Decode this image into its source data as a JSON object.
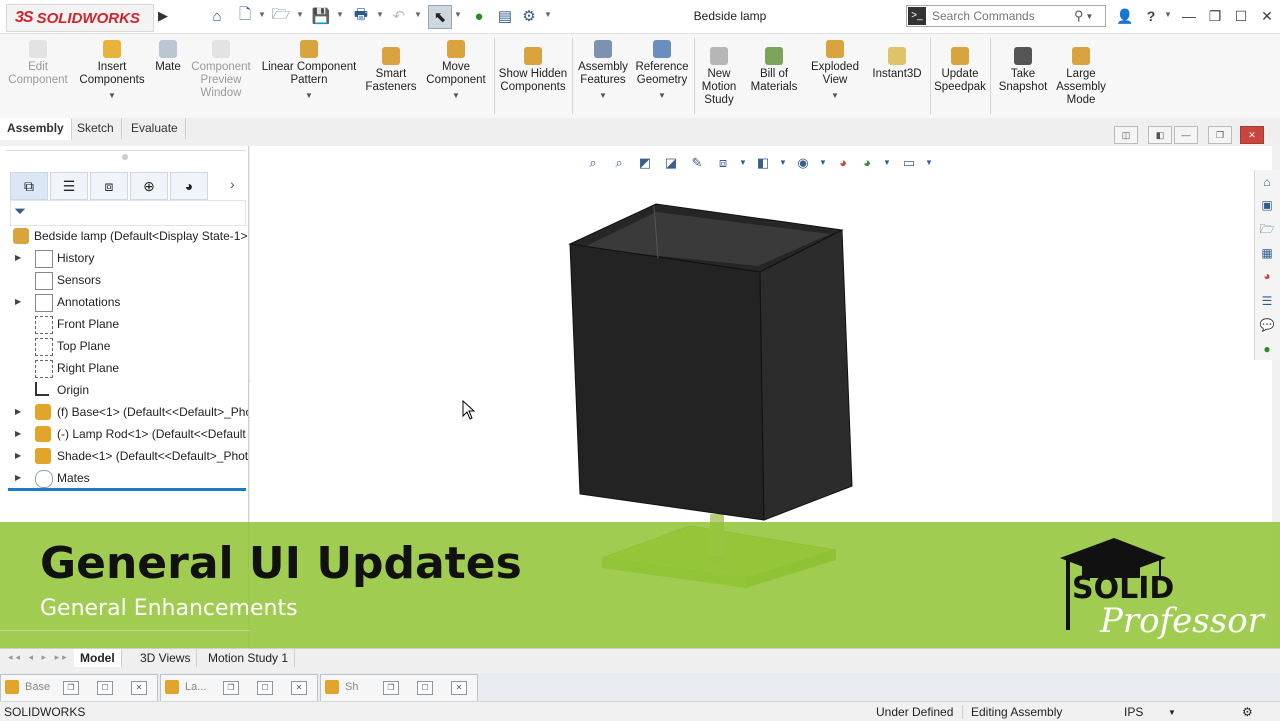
{
  "titlebar": {
    "brand_ds": "3S",
    "brand_name": "SOLIDWORKS",
    "doc_title": "Bedside lamp",
    "search_placeholder": "Search Commands",
    "help": "?",
    "minimize": "—",
    "restore": "❐",
    "maximize": "☐",
    "close": "✕"
  },
  "commands": [
    {
      "label": "Edit Component",
      "disabled": true
    },
    {
      "label": "Insert Components",
      "dropdown": true
    },
    {
      "label": "Mate"
    },
    {
      "label": "Component Preview Window",
      "disabled": true
    },
    {
      "label": "Linear Component Pattern",
      "dropdown": true
    },
    {
      "label": "Smart Fasteners"
    },
    {
      "label": "Move Component",
      "dropdown": true
    },
    {
      "label": "Show Hidden Components"
    },
    {
      "label": "Assembly Features",
      "dropdown": true
    },
    {
      "label": "Reference Geometry",
      "dropdown": true
    },
    {
      "label": "New Motion Study"
    },
    {
      "label": "Bill of Materials"
    },
    {
      "label": "Exploded View",
      "dropdown": true
    },
    {
      "label": "Instant3D"
    },
    {
      "label": "Update Speedpak"
    },
    {
      "label": "Take Snapshot"
    },
    {
      "label": "Large Assembly Mode"
    }
  ],
  "cm_tabs": [
    "Assembly",
    "Sketch",
    "Evaluate"
  ],
  "tree": {
    "root": "Bedside lamp  (Default<Display State-1>",
    "items": [
      {
        "label": "History",
        "expandable": true
      },
      {
        "label": "Sensors",
        "expandable": false
      },
      {
        "label": "Annotations",
        "expandable": true
      },
      {
        "label": "Front Plane",
        "expandable": false
      },
      {
        "label": "Top Plane",
        "expandable": false
      },
      {
        "label": "Right Plane",
        "expandable": false
      },
      {
        "label": "Origin",
        "expandable": false
      },
      {
        "label": "(f) Base<1> (Default<<Default>_Pho",
        "expandable": true
      },
      {
        "label": "(-) Lamp Rod<1> (Default<<Default",
        "expandable": true
      },
      {
        "label": "Shade<1> (Default<<Default>_Phot",
        "expandable": true
      },
      {
        "label": "Mates",
        "expandable": true
      }
    ]
  },
  "overlay": {
    "title": "General UI Updates",
    "subtitle": "General Enhancements",
    "logo_line1": "SOLID",
    "logo_line2": "Professor"
  },
  "bottom_tabs": [
    "Model",
    "3D Views",
    "Motion Study 1"
  ],
  "doc_windows": [
    "Base",
    "La...",
    "Sh"
  ],
  "status": {
    "app": "SOLIDWORKS",
    "state": "Under Defined",
    "mode": "Editing Assembly",
    "units": "IPS"
  },
  "colors": {
    "brand_red": "#d4222b",
    "overlay_green": "#92c436",
    "shade_dark": "#222222",
    "base_green": "#a8d258"
  }
}
